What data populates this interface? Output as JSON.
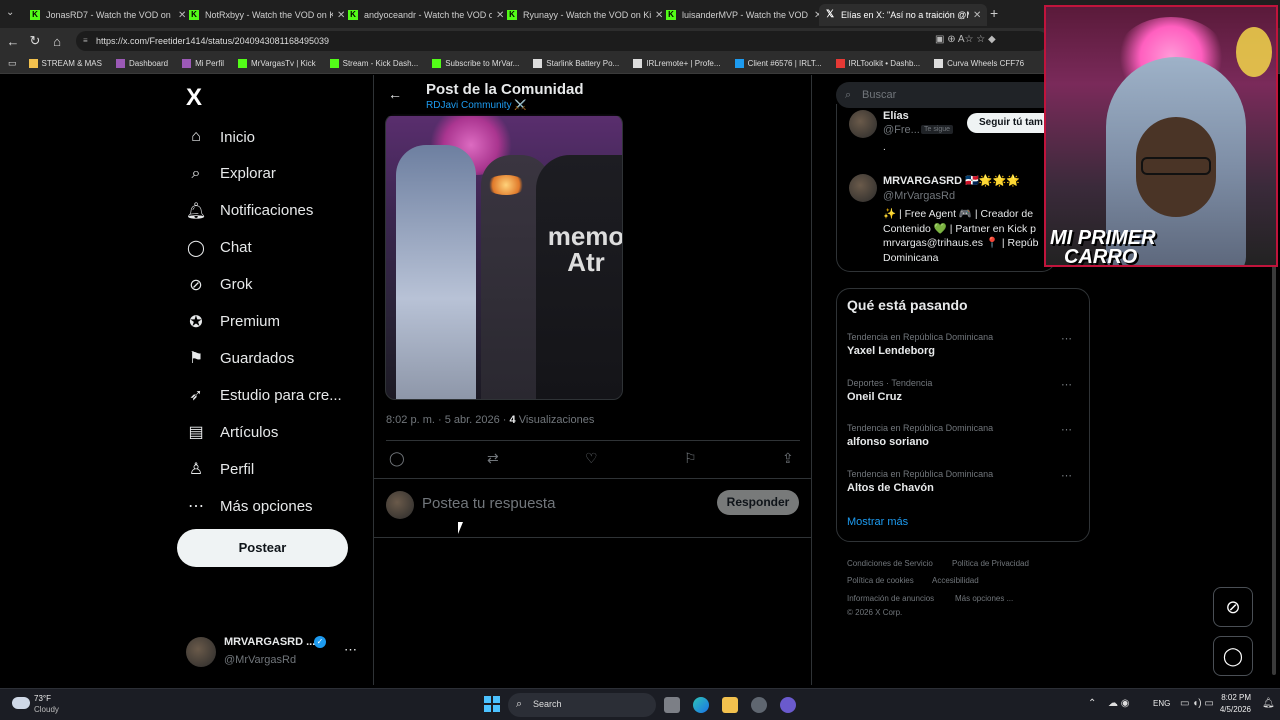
{
  "browser": {
    "tabs": [
      {
        "title": "JonasRD7 - Watch the VOD on Kic",
        "active": false,
        "x": 0
      },
      {
        "title": "NotRxbyy - Watch the VOD on Kic",
        "active": false,
        "x": 1
      },
      {
        "title": "andyoceandr - Watch the VOD on",
        "active": false,
        "x": 2
      },
      {
        "title": "Ryunayy - Watch the VOD on Kick",
        "active": false,
        "x": 3
      },
      {
        "title": "luisanderMVP - Watch the VOD on",
        "active": false,
        "x": 4
      },
      {
        "title": "Elías en X: \"Así no a traición @Mr",
        "active": true,
        "x": 5
      }
    ],
    "url": "https://x.com/Freetider1414/status/2040943081168495039",
    "bookmarks": [
      "STREAM & MAS",
      "Dashboard",
      "Mi Perfil",
      "MrVargasTv | Kick",
      "Stream - Kick Dash...",
      "Subscribe to MrVar...",
      "Starlink Battery Po...",
      "IRLremote+ | Profe...",
      "Client #6576 | IRLT...",
      "IRLToolkit • Dashb...",
      "Curva Wheels CFF76"
    ]
  },
  "sidebar": {
    "logo": "X",
    "items": [
      {
        "label": "Inicio",
        "icon": "home-icon",
        "glyph": "⌂"
      },
      {
        "label": "Explorar",
        "icon": "search-icon",
        "glyph": "⌕"
      },
      {
        "label": "Notificaciones",
        "icon": "bell-icon",
        "glyph": "🔔︎"
      },
      {
        "label": "Chat",
        "icon": "chat-icon",
        "glyph": "◯"
      },
      {
        "label": "Grok",
        "icon": "grok-icon",
        "glyph": "⊘"
      },
      {
        "label": "Premium",
        "icon": "premium-icon",
        "glyph": "✪"
      },
      {
        "label": "Guardados",
        "icon": "bookmark-icon",
        "glyph": "⚑"
      },
      {
        "label": "Estudio para cre...",
        "icon": "rocket-icon",
        "glyph": "➶"
      },
      {
        "label": "Artículos",
        "icon": "article-icon",
        "glyph": "▤"
      },
      {
        "label": "Perfil",
        "icon": "profile-icon",
        "glyph": "♙"
      },
      {
        "label": "Más opciones",
        "icon": "more-options-icon",
        "glyph": "⋯"
      }
    ],
    "post_button": "Postear",
    "account": {
      "name": "MRVARGASRD ...",
      "handle": "@MrVargasRd"
    }
  },
  "post": {
    "header_title": "Post de la Comunidad",
    "community": "RDJavi Community ⚔️",
    "image_text": "memo Atr",
    "meta_time": "8:02 p. m. · 5 abr. 2026 · ",
    "views_count": "4",
    "views_label": "Visualizaciones",
    "reply_placeholder": "Postea tu respuesta",
    "reply_button": "Responder"
  },
  "right": {
    "search_placeholder": "Buscar",
    "who": [
      {
        "name": "Elías",
        "handle": "@Fre...",
        "badge": "Te sigue",
        "button": "Seguir tú tam",
        "bio": "."
      },
      {
        "name": "MRVARGASRD 🇩🇴🌟🌟🌟",
        "handle": "@MrVargasRd",
        "bio": "✨ | Free Agent 🎮 | Creador de Contenido 💚 | Partner en Kick p mrvargas@trihaus.es 📍 | Repúb Dominicana"
      }
    ],
    "trends_title": "Qué está pasando",
    "trends": [
      {
        "sub": "Tendencia en República Dominicana",
        "name": "Yaxel Lendeborg"
      },
      {
        "sub": "Deportes · Tendencia",
        "name": "Oneil Cruz"
      },
      {
        "sub": "Tendencia en República Dominicana",
        "name": "alfonso soriano"
      },
      {
        "sub": "Tendencia en República Dominicana",
        "name": "Altos de Chavón"
      }
    ],
    "show_more": "Mostrar más",
    "footer": [
      "Condiciones de Servicio",
      "Política de Privacidad",
      "Política de cookies",
      "Accesibilidad",
      "Información de anuncios",
      "Más opciones ...",
      "© 2026 X Corp."
    ]
  },
  "webcam": {
    "overlay_line1": "MI PRIMER",
    "overlay_line2": "CARRO"
  },
  "taskbar": {
    "weather_temp": "73°F",
    "weather_desc": "Cloudy",
    "search_label": "Search",
    "lang": "ENG",
    "time": "8:02 PM",
    "date": "4/5/2026"
  },
  "colors": {
    "accent": "#1d9bf0",
    "kick_green": "#53fc18",
    "cam_border": "#c0143c"
  }
}
